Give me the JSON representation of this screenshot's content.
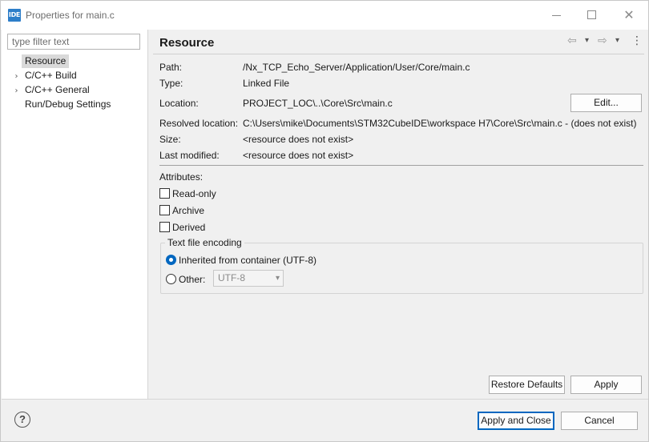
{
  "window": {
    "app_icon": "IDE",
    "title": "Properties for main.c",
    "close_glyph": "✕"
  },
  "sidebar": {
    "filter_placeholder": "type filter text",
    "items": [
      {
        "label": "Resource",
        "expandable": false,
        "selected": true
      },
      {
        "label": "C/C++ Build",
        "expandable": true,
        "selected": false
      },
      {
        "label": "C/C++ General",
        "expandable": true,
        "selected": false
      },
      {
        "label": "Run/Debug Settings",
        "expandable": false,
        "selected": false
      }
    ],
    "chevron": "›"
  },
  "page": {
    "title": "Resource",
    "nav": {
      "back": "⇦",
      "forward": "⇨",
      "dropdown": "▾",
      "menu": "⋮"
    },
    "properties": {
      "path_label": "Path:",
      "path_value": "/Nx_TCP_Echo_Server/Application/User/Core/main.c",
      "type_label": "Type:",
      "type_value": "Linked File",
      "location_label": "Location:",
      "location_value": "PROJECT_LOC\\..\\Core\\Src\\main.c",
      "edit_button": "Edit...",
      "resolved_label": "Resolved location:",
      "resolved_value": "C:\\Users\\mike\\Documents\\STM32CubeIDE\\workspace H7\\Core\\Src\\main.c - (does not exist)",
      "size_label": "Size:",
      "size_value": "<resource does not exist>",
      "modified_label": "Last modified:",
      "modified_value": "<resource does not exist>"
    },
    "attributes": {
      "heading": "Attributes:",
      "read_only": "Read-only",
      "archive": "Archive",
      "derived": "Derived"
    },
    "encoding": {
      "legend": "Text file encoding",
      "inherited": "Inherited from container (UTF-8)",
      "other": "Other:",
      "other_value": "UTF-8",
      "selected": "inherited"
    },
    "restore_defaults": "Restore Defaults",
    "apply": "Apply"
  },
  "footer": {
    "help": "?",
    "apply_and_close": "Apply and Close",
    "cancel": "Cancel"
  },
  "colors": {
    "accent": "#0067c0",
    "selection": "#d9d9d9"
  }
}
